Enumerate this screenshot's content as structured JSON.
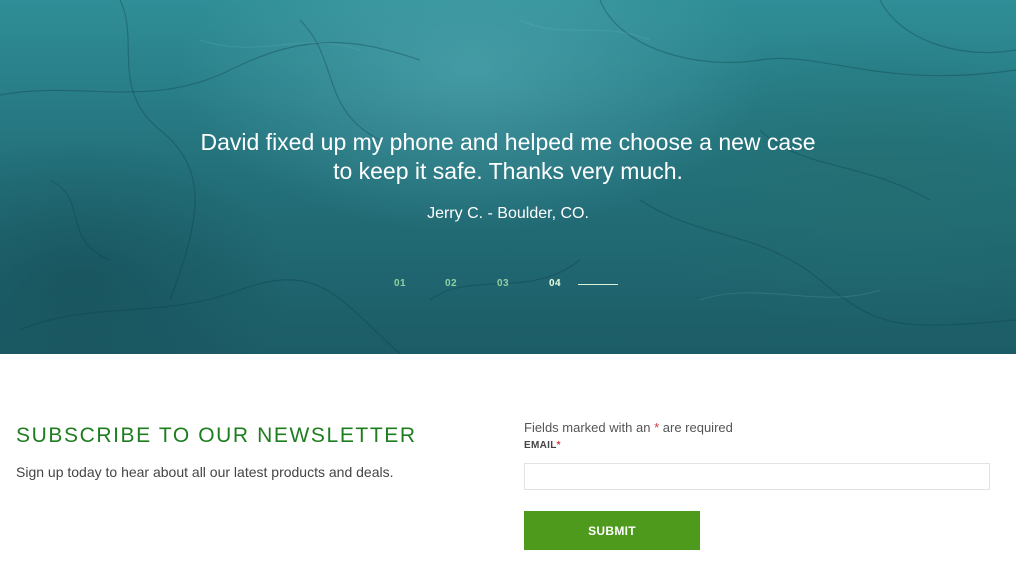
{
  "testimonial": {
    "quote": "David fixed up my phone and helped me choose a new case to keep it safe. Thanks very much.",
    "author": "Jerry C. - Boulder, CO.",
    "slides": [
      "01",
      "02",
      "03",
      "04"
    ],
    "active_slide": "04"
  },
  "newsletter": {
    "title": "SUBSCRIBE TO OUR NEWSLETTER",
    "subtitle": "Sign up today to hear about all our latest products and deals."
  },
  "form": {
    "required_note_prefix": "Fields marked with an",
    "required_star": "*",
    "required_note_suffix": "are required",
    "email_label": "EMAIL",
    "email_value": "",
    "submit_label": "SUBMIT"
  },
  "colors": {
    "hero_teal": "#24727c",
    "title_green": "#1e7d1e",
    "button_green": "#4e9a1c",
    "required_red": "#d23a3a"
  }
}
